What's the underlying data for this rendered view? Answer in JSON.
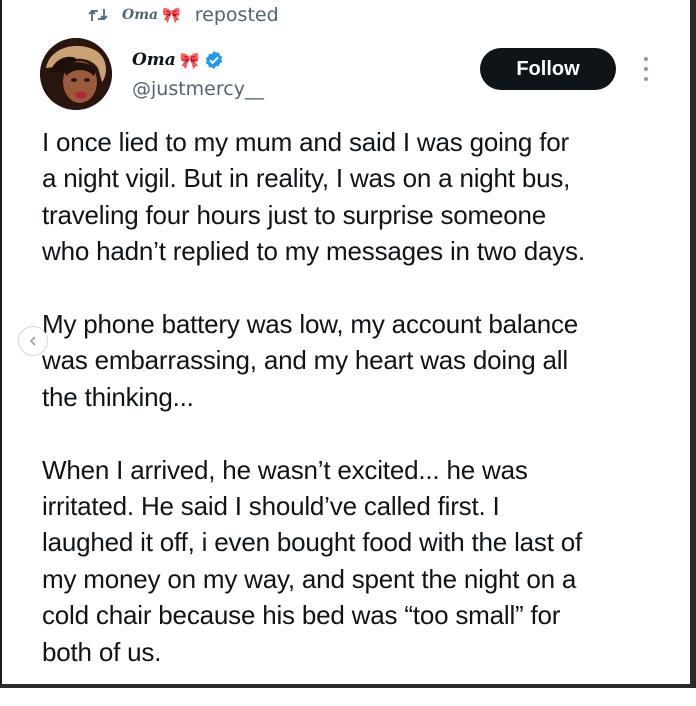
{
  "repost": {
    "icon": "repost-icon",
    "user_name": "Oma",
    "ribbon": "🎀",
    "label": "reposted"
  },
  "author": {
    "avatar": "avatar",
    "display_name": "Oma",
    "ribbon": "🎀",
    "verified_icon": "verified-badge-icon",
    "verified_color": "#1d9bf0",
    "handle": "@justmercy__"
  },
  "actions": {
    "follow_label": "Follow",
    "more_icon": "more-vertical-icon"
  },
  "tweet": {
    "paragraphs": [
      [
        "I once lied to my mum and said I was going for",
        "a night vigil. But in reality, I was on a night bus,",
        "traveling four hours just to surprise someone",
        "who hadn’t replied to my messages in two days."
      ],
      [
        "My phone battery was low, my account balance",
        "was embarrassing, and my heart was doing all",
        "the thinking..."
      ],
      [
        "When I arrived, he wasn’t excited... he was",
        "irritated. He said I should’ve called first. I",
        "laughed it off, i even bought food with the last of",
        "my money on my way, and spent the night on a",
        "cold chair because his bed was “too small” for",
        "both of us."
      ]
    ]
  },
  "carousel": {
    "prev_icon": "chevron-left-icon"
  }
}
